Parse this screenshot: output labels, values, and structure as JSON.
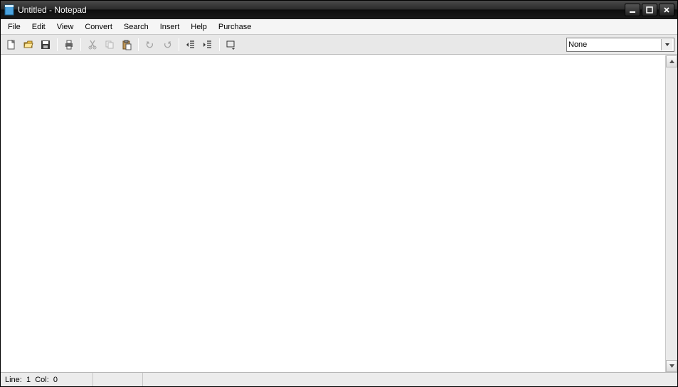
{
  "window": {
    "title": "Untitled - Notepad"
  },
  "menu": {
    "items": [
      "File",
      "Edit",
      "View",
      "Convert",
      "Search",
      "Insert",
      "Help",
      "Purchase"
    ]
  },
  "toolbar": {
    "combo_value": "None"
  },
  "editor": {
    "content": ""
  },
  "status": {
    "line_label": "Line:",
    "line_value": "1",
    "col_label": "Col:",
    "col_value": "0"
  }
}
